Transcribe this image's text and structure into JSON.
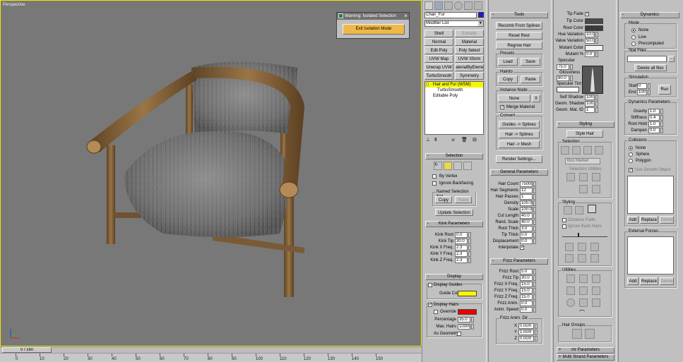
{
  "viewport": {
    "label": "Perspective",
    "background": "#787878",
    "time_slider": "0 / 160",
    "ruler_ticks": [
      "0",
      "10",
      "20",
      "30",
      "40",
      "50",
      "60",
      "70",
      "80",
      "90",
      "100",
      "110",
      "120",
      "130",
      "140",
      "150"
    ]
  },
  "warning_dialog": {
    "title": "Warning: Isolated Selection",
    "button": "Exit Isolation Mode",
    "button_color": "#f0b848"
  },
  "panel1": {
    "object_name": "Chair_Fur",
    "object_color": "#1b1bd6",
    "modifier_list": "Modifier List",
    "buttons": [
      [
        "Shell",
        "Extrude"
      ],
      [
        "Normal",
        "Material"
      ],
      [
        "Edit Poly",
        "Poly Select"
      ],
      [
        "UVW Map",
        "UVW Xform"
      ],
      [
        "Unwrap UVW",
        "aterialByEleme"
      ],
      [
        "TurboSmooth",
        "Symmetry"
      ]
    ],
    "stack": [
      "Hair and Fur (WSM)",
      "TurboSmooth",
      "Editable Poly"
    ],
    "selection": {
      "title": "Selection",
      "by_vertex": "By Vertex",
      "ignore_backfacing": "Ignore Backfacing",
      "named_sel": "Named Selection Set",
      "copy": "Copy",
      "paste": "Paste",
      "update": "Update Selection"
    },
    "kink": {
      "title": "Kink Parameters",
      "rows": [
        {
          "label": "Kink Root",
          "value": "0.0"
        },
        {
          "label": "Kink Tip",
          "value": "30.0"
        },
        {
          "label": "Kink X Freq.",
          "value": "2.3"
        },
        {
          "label": "Kink Y Freq.",
          "value": "2.3"
        },
        {
          "label": "Kink Z Freq.",
          "value": "2.3"
        }
      ]
    },
    "display": {
      "title": "Display",
      "display_guides": "Display Guides",
      "guide_color_label": "Guide Color",
      "guide_color": "#f6f600",
      "display_hairs": "Display Hairs",
      "override": "Override",
      "override_color": "#e80000",
      "percentage_label": "Percentage",
      "percentage": "35.0",
      "max_hairs_label": "Max. Hairs",
      "max_hairs": "100000",
      "as_geometry": "As Geometry"
    }
  },
  "panel2": {
    "tools": {
      "title": "Tools",
      "recomb": "Recomb From Splines",
      "reset_rest": "Reset Rest",
      "regrow": "Regrow Hair",
      "presets": "Presets",
      "load": "Load",
      "save": "Save",
      "hairdo": "Hairdo",
      "copy": "Copy",
      "paste": "Paste",
      "instance_node": "Instance Node",
      "none": "None",
      "x": "X",
      "merge_material": "Merge Material",
      "convert": "Convert",
      "guides_splines": "Guides -> Splines",
      "hair_splines": "Hair -> Splines",
      "hair_mesh": "Hair -> Mesh",
      "render_settings": "Render Settings..."
    },
    "general": {
      "title": "General Parameters",
      "rows": [
        {
          "label": "Hair Count",
          "value": "75000"
        },
        {
          "label": "Hair Segments",
          "value": "12"
        },
        {
          "label": "Hair Passes",
          "value": "1"
        },
        {
          "label": "Density",
          "value": "100.0"
        },
        {
          "label": "Scale",
          "value": "100.0"
        },
        {
          "label": "Cut Length",
          "value": "40.0"
        },
        {
          "label": "Rand. Scale",
          "value": "40.0"
        },
        {
          "label": "Root Thick",
          "value": "3.0"
        },
        {
          "label": "Tip Thick",
          "value": "0.0"
        },
        {
          "label": "Displacement",
          "value": "0.0"
        }
      ],
      "interpolate": "Interpolate"
    },
    "frizz": {
      "title": "Frizz Parameters",
      "rows": [
        {
          "label": "Frizz Root",
          "value": "5.0"
        },
        {
          "label": "Frizz Tip",
          "value": "30.0"
        },
        {
          "label": "Frizz X Freq.",
          "value": "15.0"
        },
        {
          "label": "Frizz Y Freq.",
          "value": "15.0"
        },
        {
          "label": "Frizz Z Freq.",
          "value": "15.0"
        },
        {
          "label": "Frizz Anim.",
          "value": "0.0"
        },
        {
          "label": "Anim. Speed",
          "value": "0.0"
        }
      ],
      "dir_label": "Frizz Anim. Dir.",
      "dir": [
        {
          "label": "X",
          "value": "0.0cm"
        },
        {
          "label": "Y",
          "value": "1.0cm"
        },
        {
          "label": "Z",
          "value": "0.0cm"
        }
      ]
    }
  },
  "panel3": {
    "material": {
      "tip_fade": "Tip Fade",
      "tip_color_label": "Tip Color",
      "tip_color": "#4a4a4a",
      "root_color_label": "Root Color",
      "root_color": "#3a3a3a",
      "rows": [
        {
          "label": "Hue Variation",
          "value": "10.0"
        },
        {
          "label": "Value Variation",
          "value": "50.0"
        }
      ],
      "mutant_color_label": "Mutant Color",
      "mutant_color": "#f2f2f2",
      "mutant_pct_label": "Mutant %",
      "mutant_pct": "0.0",
      "specular_label": "Specular",
      "specular": "75.0",
      "glossiness_label": "Glossiness",
      "glossiness": "80.0",
      "specular_tint_label": "Specular Tint",
      "specular_tint": "#ffffff",
      "rows2": [
        {
          "label": "Self Shadow",
          "value": "100.0"
        },
        {
          "label": "Geom. Shadow",
          "value": "100.0"
        },
        {
          "label": "Geom. Mat. ID",
          "value": "1"
        }
      ]
    },
    "styling": {
      "title": "Styling",
      "style_hair": "Style Hair",
      "selection": "Selection",
      "box_marker": "Box Marker",
      "selection_utilities": "Selection Utilities",
      "styling_grp": "Styling",
      "distance_fade": "Distance Fade",
      "ignore_back_hairs": "Ignore Back Hairs",
      "utilities": "Utilities",
      "hair_groups": "Hair Groups"
    },
    "mr_params": "mr Parameters",
    "multi_strand": "Multi Strand Parameters"
  },
  "panel4": {
    "dynamics": {
      "title": "Dynamics",
      "mode": "Mode",
      "modes": [
        "None",
        "Live",
        "Precomputed"
      ],
      "stat_files": "Stat Files",
      "delete_all": "Delete all files",
      "browse": "...",
      "simulation": "Simulation",
      "start_label": "Start",
      "start": "0",
      "end_label": "End",
      "end": "100",
      "run": "Run",
      "dyn_params": "Dynamics Parameters",
      "params": [
        {
          "label": "Gravity",
          "value": "1.0"
        },
        {
          "label": "Stiffness",
          "value": "0.4"
        },
        {
          "label": "Root Hold",
          "value": "1.0"
        },
        {
          "label": "Dampen",
          "value": "0.0"
        }
      ],
      "collisions": "Collisions",
      "coll_modes": [
        "None",
        "Sphere",
        "Polygon"
      ],
      "use_growth": "Use Growth Object",
      "add": "Add",
      "replace": "Replace",
      "delete": "Delete",
      "external_forces": "External Forces"
    }
  }
}
